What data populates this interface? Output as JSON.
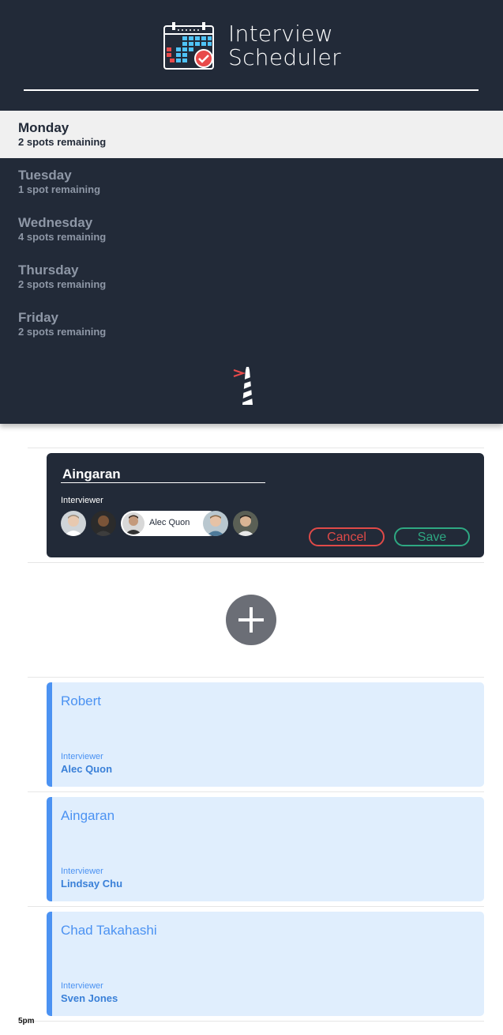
{
  "app": {
    "title_line1": "Interview",
    "title_line2": "Scheduler"
  },
  "days": [
    {
      "name": "Monday",
      "spots": "2 spots remaining",
      "selected": true
    },
    {
      "name": "Tuesday",
      "spots": "1 spot remaining",
      "selected": false
    },
    {
      "name": "Wednesday",
      "spots": "4 spots remaining",
      "selected": false
    },
    {
      "name": "Thursday",
      "spots": "2 spots remaining",
      "selected": false
    },
    {
      "name": "Friday",
      "spots": "2 spots remaining",
      "selected": false
    }
  ],
  "editor": {
    "student_name": "Aingaran",
    "interviewer_label": "Interviewer",
    "selected_interviewer": "Alec Quon",
    "cancel_label": "Cancel",
    "save_label": "Save"
  },
  "appointments": [
    {
      "student": "Robert",
      "interviewer_label": "Interviewer",
      "interviewer": "Alec Quon"
    },
    {
      "student": "Aingaran",
      "interviewer_label": "Interviewer",
      "interviewer": "Lindsay Chu"
    },
    {
      "student": "Chad Takahashi",
      "interviewer_label": "Interviewer",
      "interviewer": "Sven Jones"
    }
  ],
  "time_label": "5pm",
  "colors": {
    "dark_bg": "#222a38",
    "selected_day_bg": "#f0f0f0",
    "cancel": "#e04a48",
    "save": "#2ea882",
    "appointment_bg": "#e0eefd",
    "appointment_accent": "#4b92f2"
  },
  "icons": {
    "logo": "calendar-check-icon",
    "footer": "lighthouse-icon",
    "add": "plus-icon"
  }
}
